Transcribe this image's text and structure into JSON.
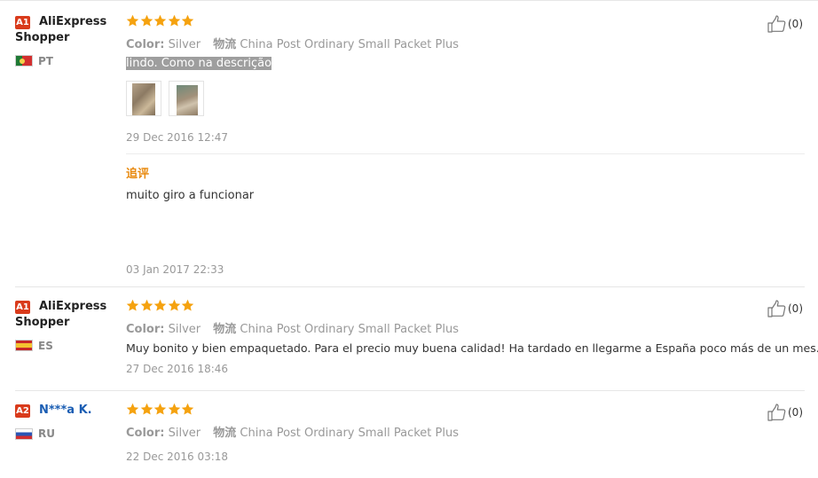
{
  "reviews": [
    {
      "badge": "A1",
      "user": "AliExpress Shopper",
      "country": "PT",
      "rating": 5,
      "color_label": "Color:",
      "color_value": "Silver",
      "ship_label": "物流",
      "ship_value": "China Post Ordinary Small Packet Plus",
      "text": "lindo. Como na descrição",
      "date": "29 Dec 2016 12:47",
      "append_label": "追评",
      "append_text": "muito giro a funcionar",
      "append_date": "03 Jan 2017 22:33",
      "likes": "(0)"
    },
    {
      "badge": "A1",
      "user": "AliExpress Shopper",
      "country": "ES",
      "rating": 5,
      "color_label": "Color:",
      "color_value": "Silver",
      "ship_label": "物流",
      "ship_value": "China Post Ordinary Small Packet Plus",
      "text": "Muy bonito y bien empaquetado. Para el precio muy buena calidad! Ha tardado en llegarme a España poco más de un mes.",
      "date": "27 Dec 2016 18:46",
      "likes": "(0)"
    },
    {
      "badge": "A2",
      "user": "N***a K.",
      "country": "RU",
      "rating": 5,
      "color_label": "Color:",
      "color_value": "Silver",
      "ship_label": "物流",
      "ship_value": "China Post Ordinary Small Packet Plus",
      "date": "22 Dec 2016 03:18",
      "likes": "(0)"
    }
  ],
  "colors": {
    "star": "#f5a20f",
    "badge": "#d93b1c",
    "append": "#e88a10",
    "highlight": "#9e9e9e"
  }
}
